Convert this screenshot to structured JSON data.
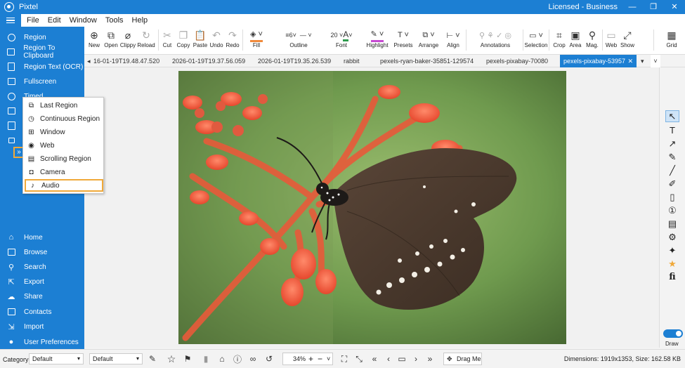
{
  "app": {
    "title": "Pixtel",
    "license": "Licensed - Business",
    "min": "—",
    "restore": "❐",
    "close": "✕"
  },
  "menu": [
    "File",
    "Edit",
    "Window",
    "Tools",
    "Help"
  ],
  "sidebar": {
    "top": [
      {
        "label": "Region",
        "icon": "region-icon"
      },
      {
        "label": "Region To Clipboard",
        "icon": "clipboard-icon"
      },
      {
        "label": "Region Text (OCR)",
        "icon": "ocr-icon"
      },
      {
        "label": "Fullscreen",
        "icon": "fullscreen-icon"
      },
      {
        "label": "Timed",
        "icon": "timer-icon"
      }
    ],
    "bottom": [
      {
        "label": "Home",
        "icon": "home-icon"
      },
      {
        "label": "Browse",
        "icon": "browse-icon"
      },
      {
        "label": "Search",
        "icon": "search-icon"
      },
      {
        "label": "Export",
        "icon": "export-icon"
      },
      {
        "label": "Share",
        "icon": "share-icon"
      },
      {
        "label": "Contacts",
        "icon": "contacts-icon"
      },
      {
        "label": "Import",
        "icon": "import-icon"
      },
      {
        "label": "User Preferences",
        "icon": "user-icon"
      }
    ],
    "expand": "»"
  },
  "popup": [
    "Last Region",
    "Continuous Region",
    "Window",
    "Web",
    "Scrolling Region",
    "Camera",
    "Audio"
  ],
  "toolbar": {
    "buttons": [
      "New",
      "Open",
      "Clippy",
      "Reload",
      "Cut",
      "Copy",
      "Paste",
      "Undo",
      "Redo",
      "Fill",
      "Outline",
      "Font",
      "Highlight",
      "Presets",
      "Arrange",
      "Align",
      "Annotations",
      "Selection",
      "Crop",
      "Area",
      "Mag.",
      "Web",
      "Show",
      "Grid"
    ],
    "outline_width": "6",
    "font_size": "20"
  },
  "tabs": [
    "16-01-19T19.48.47.520",
    "2026-01-19T19.37.56.059",
    "2026-01-19T19.35.26.539",
    "rabbit",
    "pexels-ryan-baker-35851-129574",
    "pexels-pixabay-70080",
    "pexels-pixabay-53957"
  ],
  "status": {
    "category_label": "Category",
    "category_value": "Default",
    "second_value": "Default",
    "zoom": "34%",
    "drag": "Drag Me",
    "dimensions": "Dimensions: 1919x1353, Size: 162.58 KB"
  },
  "rpanel": {
    "draw": "Draw"
  },
  "colors": {
    "accent": "#1c7fd3",
    "highlight": "#f0a93a"
  }
}
